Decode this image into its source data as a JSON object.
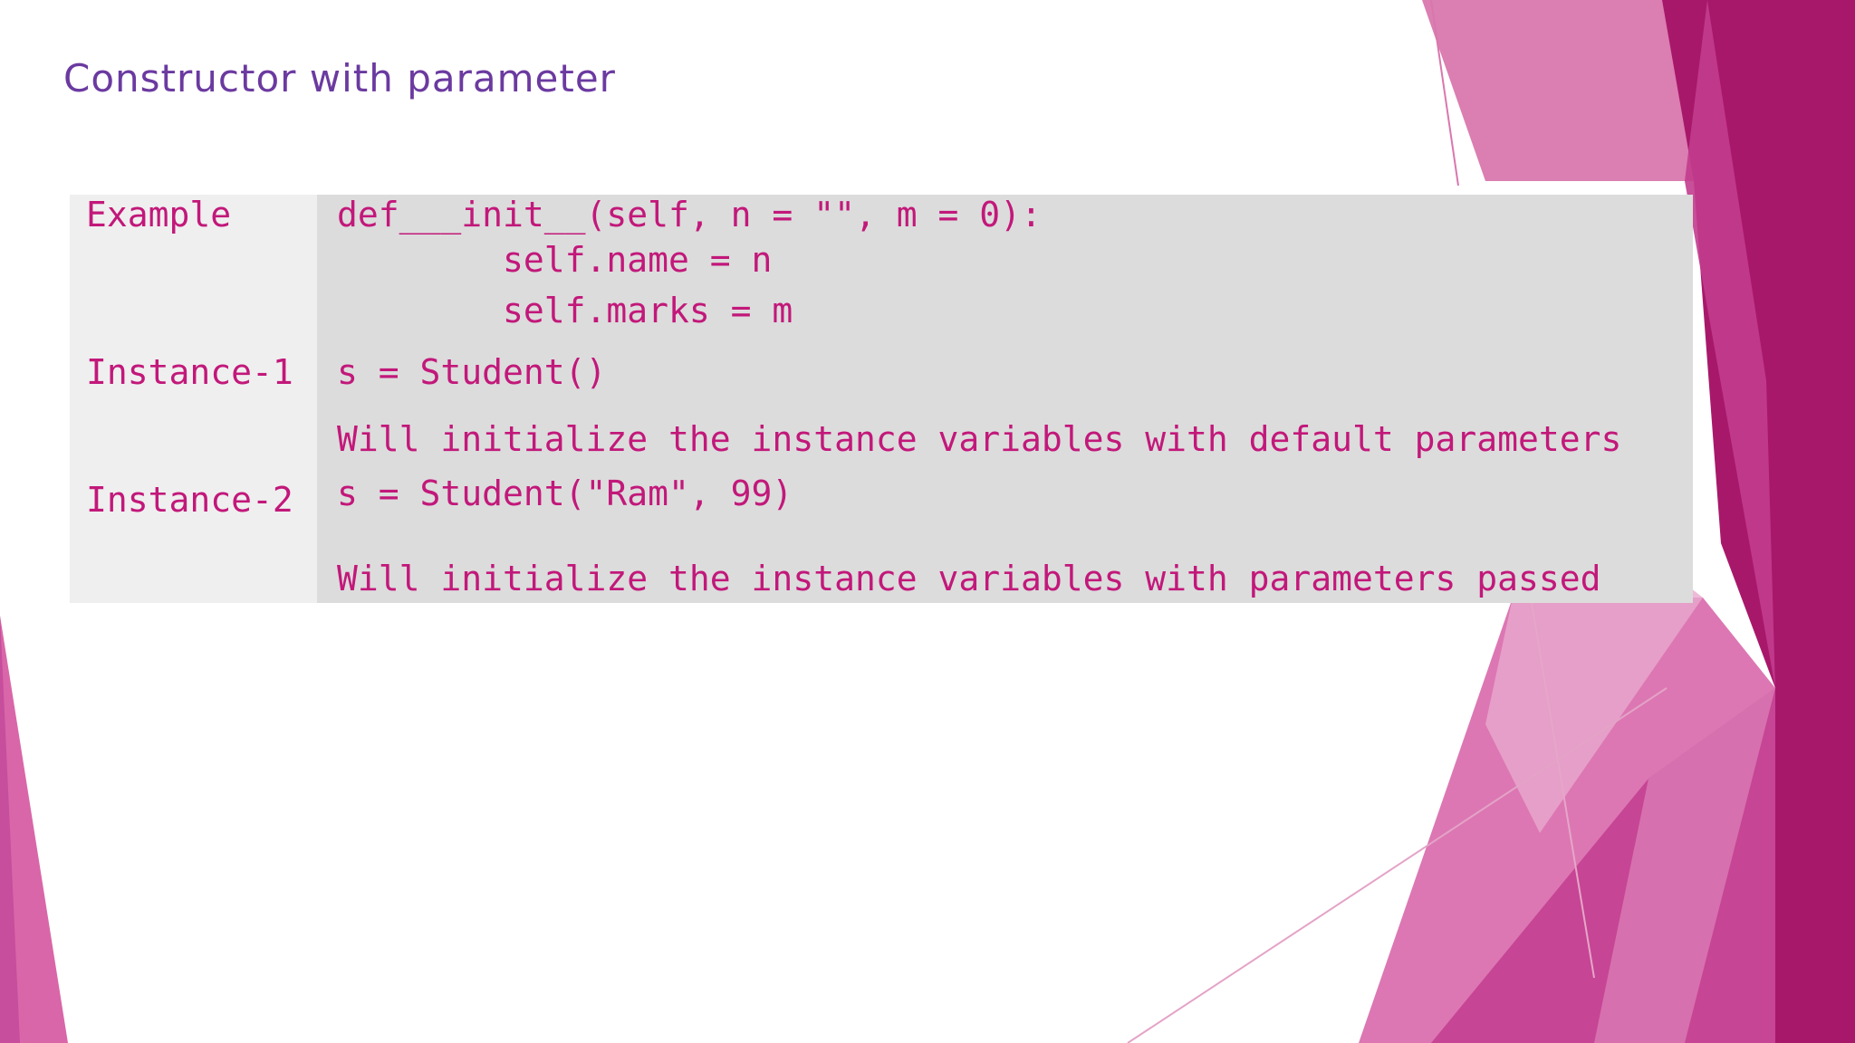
{
  "slide": {
    "title": "Constructor with parameter"
  },
  "table": {
    "rows": [
      {
        "label": "Example",
        "lines": [
          "def___init__(self, n = \"\", m = 0):",
          "        self.name = n",
          "        self.marks = m"
        ]
      },
      {
        "label": "Instance-1",
        "lines": [
          "s = Student()",
          "Will initialize the instance variables with default parameters"
        ]
      },
      {
        "label": "Instance-2",
        "lines": [
          "s = Student(\"Ram\", 99)",
          "Will initialize the instance variables with parameters passed"
        ]
      }
    ]
  },
  "colors": {
    "title": "#6b3aa0",
    "code_text": "#c2187a",
    "label_bg": "#efefef",
    "code_bg": "#dcdcdc",
    "accent_magenta": "#a8186a"
  }
}
